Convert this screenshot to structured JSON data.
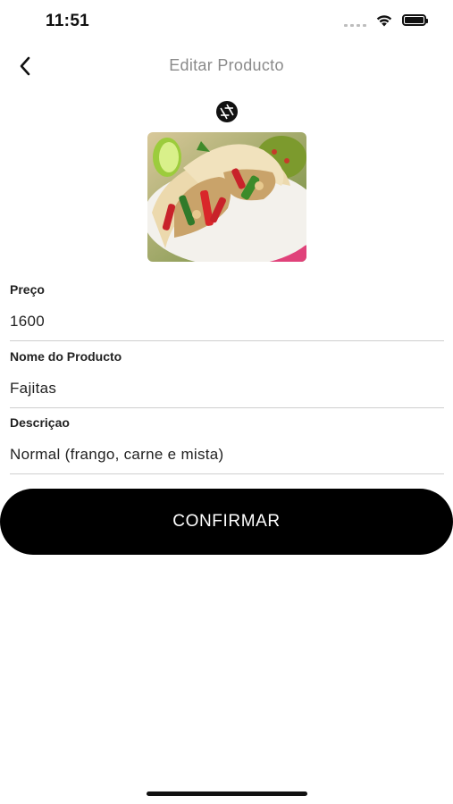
{
  "status_bar": {
    "time": "11:51"
  },
  "nav": {
    "title": "Editar Producto"
  },
  "form": {
    "price": {
      "label": "Preço",
      "value": "1600"
    },
    "name": {
      "label": "Nome do Producto",
      "value": "Fajitas"
    },
    "description": {
      "label": "Descriçao",
      "value": "Normal (frango, carne e mista)"
    }
  },
  "confirm_button": {
    "label": "CONFIRMAR"
  },
  "icons": {
    "back": "chevron-left-icon",
    "camera": "camera-aperture-icon",
    "wifi": "wifi-icon",
    "battery": "battery-icon",
    "signal": "cellular-signal-icon"
  },
  "colors": {
    "primary_button": "#000000",
    "button_text": "#ffffff",
    "title": "#8a8a8a",
    "divider": "#cfcfcf"
  }
}
